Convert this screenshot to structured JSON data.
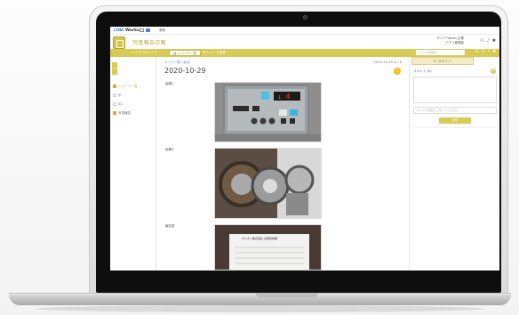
{
  "topbar": {
    "brand_prefix": "LINE",
    "brand_name": "Works",
    "label": "業務"
  },
  "header": {
    "app_title": "写真報告日報",
    "user_org": "サンワ Works 企業",
    "user_name": "アプリ管理者"
  },
  "tabs": [
    {
      "label": "アプリのトップ"
    },
    {
      "label": "レコード一覧"
    },
    {
      "label": "レコード登録"
    }
  ],
  "search": {
    "placeholder": "アプリ内を検索"
  },
  "sidebar": {
    "toggle": "«",
    "items": [
      {
        "label": "レコード一覧"
      },
      {
        "label": "ボ"
      },
      {
        "label": "02"
      },
      {
        "label": "写真報告"
      }
    ]
  },
  "main": {
    "breadcrumb": "ページ一覧へ戻る",
    "nav_info": "2020-10-29",
    "page_counter": "6 / 8",
    "record_date": "2020-10-29",
    "rows": [
      {
        "label": "画像2"
      },
      {
        "label": "画像4"
      },
      {
        "label": "報告書"
      }
    ],
    "doc_title": "タイタン株式会社 点検報告書"
  },
  "comments": {
    "tab_label": "コメント",
    "count_label": "コメント (0)",
    "mention_placeholder": "コメントを書きこみしてください",
    "send_label": "送信"
  },
  "colors": {
    "accent": "#d8cb55",
    "accent_dark": "#b8a833",
    "link": "#4a7bd0"
  }
}
